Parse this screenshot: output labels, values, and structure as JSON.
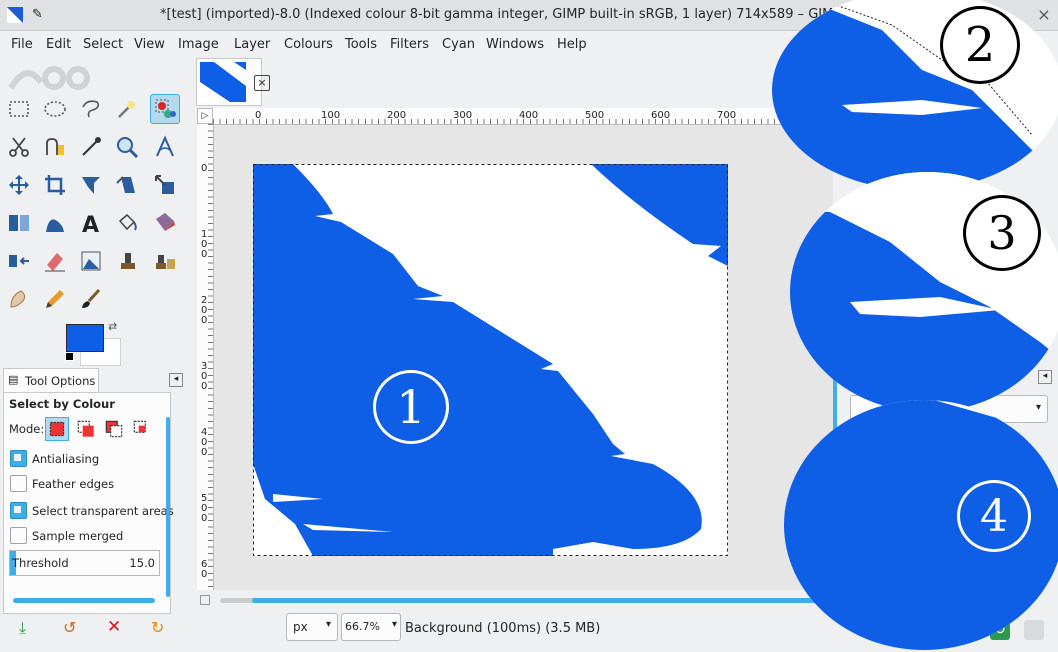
{
  "window": {
    "title": "*[test] (imported)-8.0 (Indexed colour 8-bit gamma integer, GIMP built-in sRGB, 1 layer) 714x589 – GIMP",
    "close_symbol": "×"
  },
  "menu": [
    "File",
    "Edit",
    "Select",
    "View",
    "Image",
    "Layer",
    "Colours",
    "Tools",
    "Filters",
    "Cyan",
    "Windows",
    "Help"
  ],
  "tools": [
    {
      "icon": "rect-select-icon"
    },
    {
      "icon": "ellipse-select-icon"
    },
    {
      "icon": "free-select-icon"
    },
    {
      "icon": "fuzzy-select-icon"
    },
    {
      "icon": "select-by-colour-icon",
      "active": true
    },
    {
      "icon": "scissors-select-icon"
    },
    {
      "icon": "foreground-select-icon"
    },
    {
      "icon": "paths-icon"
    },
    {
      "icon": "zoom-icon"
    },
    {
      "icon": "measure-icon"
    },
    {
      "icon": "move-icon"
    },
    {
      "icon": "crop-icon"
    },
    {
      "icon": "unified-transform-icon"
    },
    {
      "icon": "shear-icon"
    },
    {
      "icon": "scale-icon"
    },
    {
      "icon": "flip-icon"
    },
    {
      "icon": "warp-transform-icon"
    },
    {
      "icon": "text-icon"
    },
    {
      "icon": "bucket-fill-icon"
    },
    {
      "icon": "gradient-icon"
    },
    {
      "icon": "align-icon"
    },
    {
      "icon": "eraser-icon"
    },
    {
      "icon": "image-icon"
    },
    {
      "icon": "clone-icon"
    },
    {
      "icon": "heal-icon"
    },
    {
      "icon": "smudge-icon"
    },
    {
      "icon": "pencil-icon"
    },
    {
      "icon": "paintbrush-icon"
    }
  ],
  "colors": {
    "foreground": "#0f5ee6",
    "background": "#ffffff",
    "accent": "#3daee9",
    "image_blue": "#0f5ee6"
  },
  "tool_options": {
    "tab_label": "Tool Options",
    "title": "Select by Colour",
    "mode_label": "Mode:",
    "antialiasing": {
      "label": "Antialiasing",
      "checked": true
    },
    "feather_edges": {
      "label": "Feather edges",
      "checked": false
    },
    "select_transparent": {
      "label": "Select transparent areas",
      "checked": true
    },
    "sample_merged": {
      "label": "Sample merged",
      "checked": false
    },
    "threshold": {
      "label": "Threshold",
      "value": "15.0"
    }
  },
  "rulers": {
    "top": [
      "0",
      "100",
      "200",
      "300",
      "400",
      "500",
      "600",
      "700"
    ],
    "left": [
      "0",
      "1\n0\n0",
      "2\n0\n0",
      "3\n0\n0",
      "4\n0\n0",
      "5\n0\n0",
      "6\n0"
    ]
  },
  "status": {
    "unit": "px",
    "zoom": "66.7%",
    "layer_info": "Background (100ms) (3.5 MB)"
  },
  "callouts": [
    "1",
    "2",
    "3",
    "4"
  ]
}
